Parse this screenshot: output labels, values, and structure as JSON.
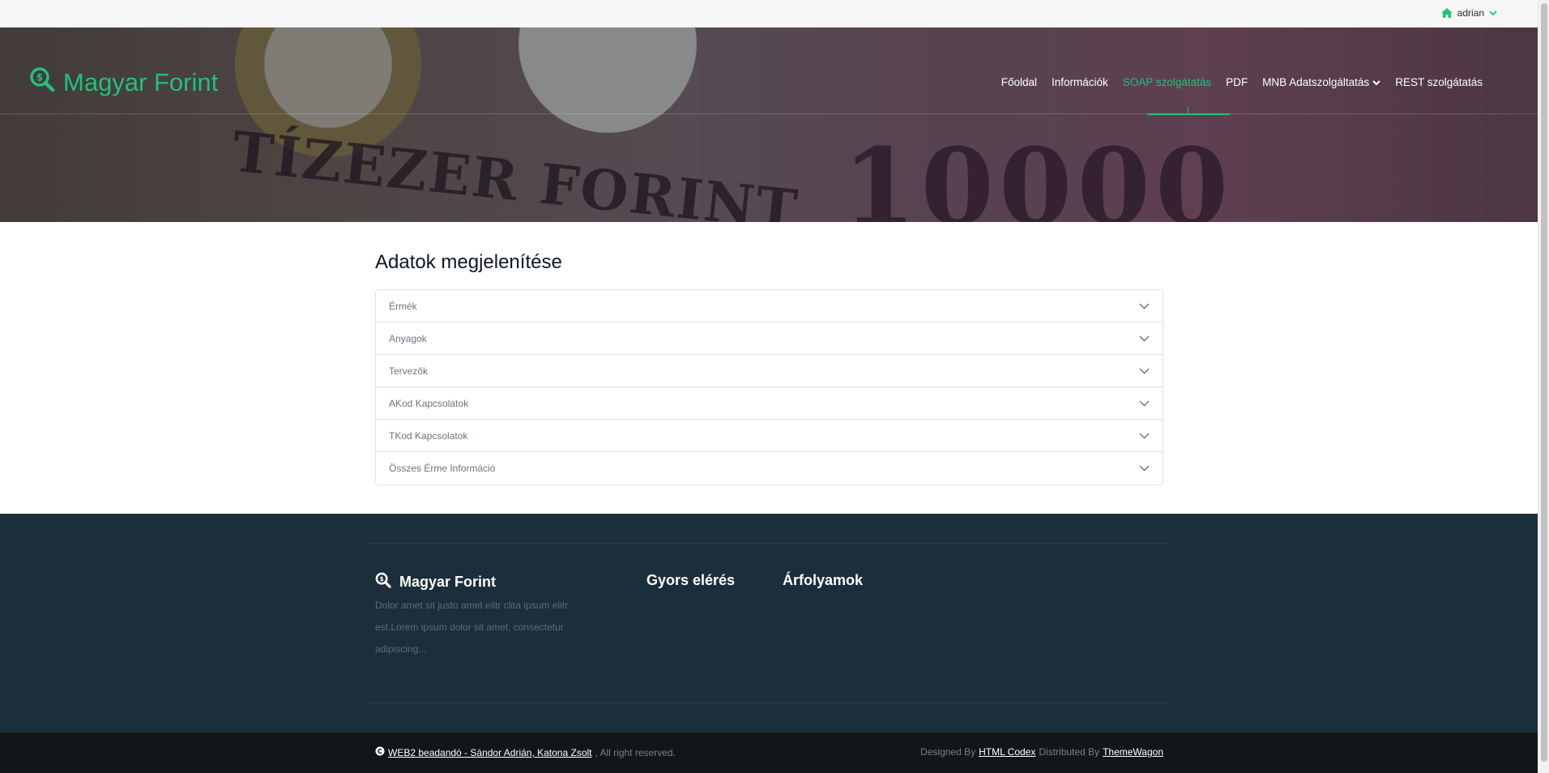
{
  "colors": {
    "accent": "#20c17a",
    "footer_bg": "#1b2e3b",
    "copybar_bg": "#131618"
  },
  "topbar": {
    "user_name": "adrian",
    "home_icon": "home-icon",
    "chevron_icon": "chevron-down-icon"
  },
  "header": {
    "brand": "Magyar Forint",
    "brand_icon": "search-dollar-icon",
    "hero_text_1": "TÍZEZER FORINT",
    "hero_text_2": "10000",
    "nav": [
      {
        "label": "Főoldal",
        "active": false
      },
      {
        "label": "Információk",
        "active": false
      },
      {
        "label": "SOAP szolgátatás",
        "active": true
      },
      {
        "label": "PDF",
        "active": false
      },
      {
        "label": "MNB Adatszolgáltatás",
        "active": false,
        "dropdown": true
      },
      {
        "label": "REST szolgátatás",
        "active": false
      }
    ]
  },
  "main": {
    "title": "Adatok megjelenítése",
    "accordion": [
      {
        "label": "Érmék"
      },
      {
        "label": "Anyagok"
      },
      {
        "label": "Tervezők"
      },
      {
        "label": "AKod Kapcsolatok"
      },
      {
        "label": "TKod Kapcsolatok"
      },
      {
        "label": "Összes Érme Információ"
      }
    ]
  },
  "footer": {
    "brand": "Magyar Forint",
    "description": "Dolor amet sit justo amet elitr clita ipsum elitr est.Lorem ipsum dolor sit amet, consectetur adipiscing...",
    "col2_title": "Gyors elérés",
    "col3_title": "Árfolyamok",
    "copyright_link": "WEB2 beadandó - Sándor Adrián, Katona Zsolt",
    "copyright_suffix": ", All right reserved.",
    "designed_by_prefix": "Designed By",
    "designed_by_link": "HTML Codex",
    "distributed_by_prefix": "Distributed By",
    "distributed_by_link": "ThemeWagon"
  }
}
